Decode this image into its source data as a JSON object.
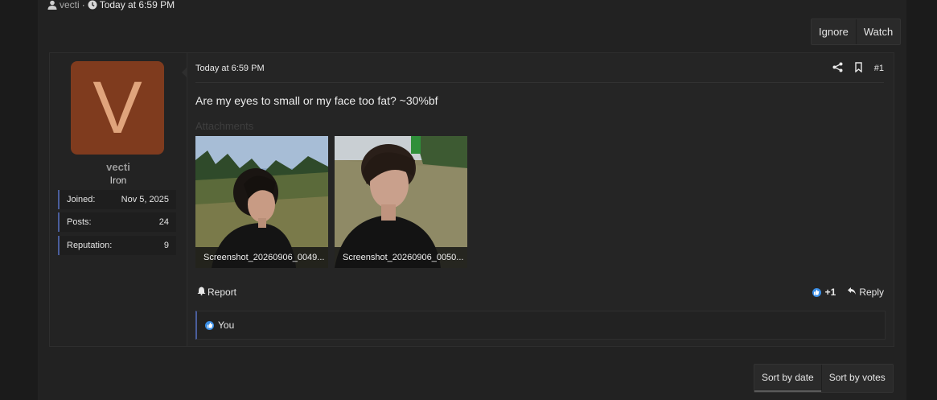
{
  "thread_meta": {
    "author": "vecti",
    "separator": "·",
    "time": "Today at 6:59 PM"
  },
  "thread_actions": {
    "ignore": "Ignore",
    "watch": "Watch"
  },
  "post": {
    "avatar_letter": "V",
    "avatar_color": "#7f3b1e",
    "username": "vecti",
    "user_title": "Iron",
    "stats": [
      {
        "label": "Joined:",
        "value": "Nov 5, 2025"
      },
      {
        "label": "Posts:",
        "value": "24"
      },
      {
        "label": "Reputation:",
        "value": "9"
      }
    ],
    "date": "Today at 6:59 PM",
    "post_number": "#1",
    "message": "Are my eyes to small or my face too fat? ~30%bf",
    "attachments_label": "Attachments",
    "attachments": [
      {
        "caption": "Screenshot_20260906_0049..."
      },
      {
        "caption": "Screenshot_20260906_0050..."
      }
    ],
    "report_label": "Report",
    "reaction_count": "+1",
    "reply_label": "Reply",
    "reacted_by": "You"
  },
  "sort": {
    "by_date": "Sort by date",
    "by_votes": "Sort by votes"
  }
}
